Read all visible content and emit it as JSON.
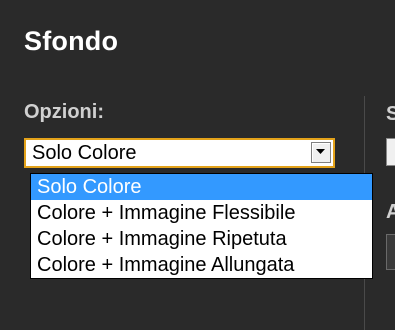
{
  "panel": {
    "title": "Sfondo",
    "options_label": "Opzioni:"
  },
  "right_column": {
    "label_a": "S",
    "label_b": "A"
  },
  "select": {
    "value": "Solo Colore",
    "arrow_icon": "chevron-down-icon",
    "focus_border_color": "#e3a21a",
    "options": [
      "Solo Colore",
      "Colore + Immagine Flessibile",
      "Colore + Immagine Ripetuta",
      "Colore + Immagine Allungata"
    ],
    "highlighted_index": 0,
    "highlight_color": "#3399ff"
  },
  "background_color": "#2a2a2a"
}
